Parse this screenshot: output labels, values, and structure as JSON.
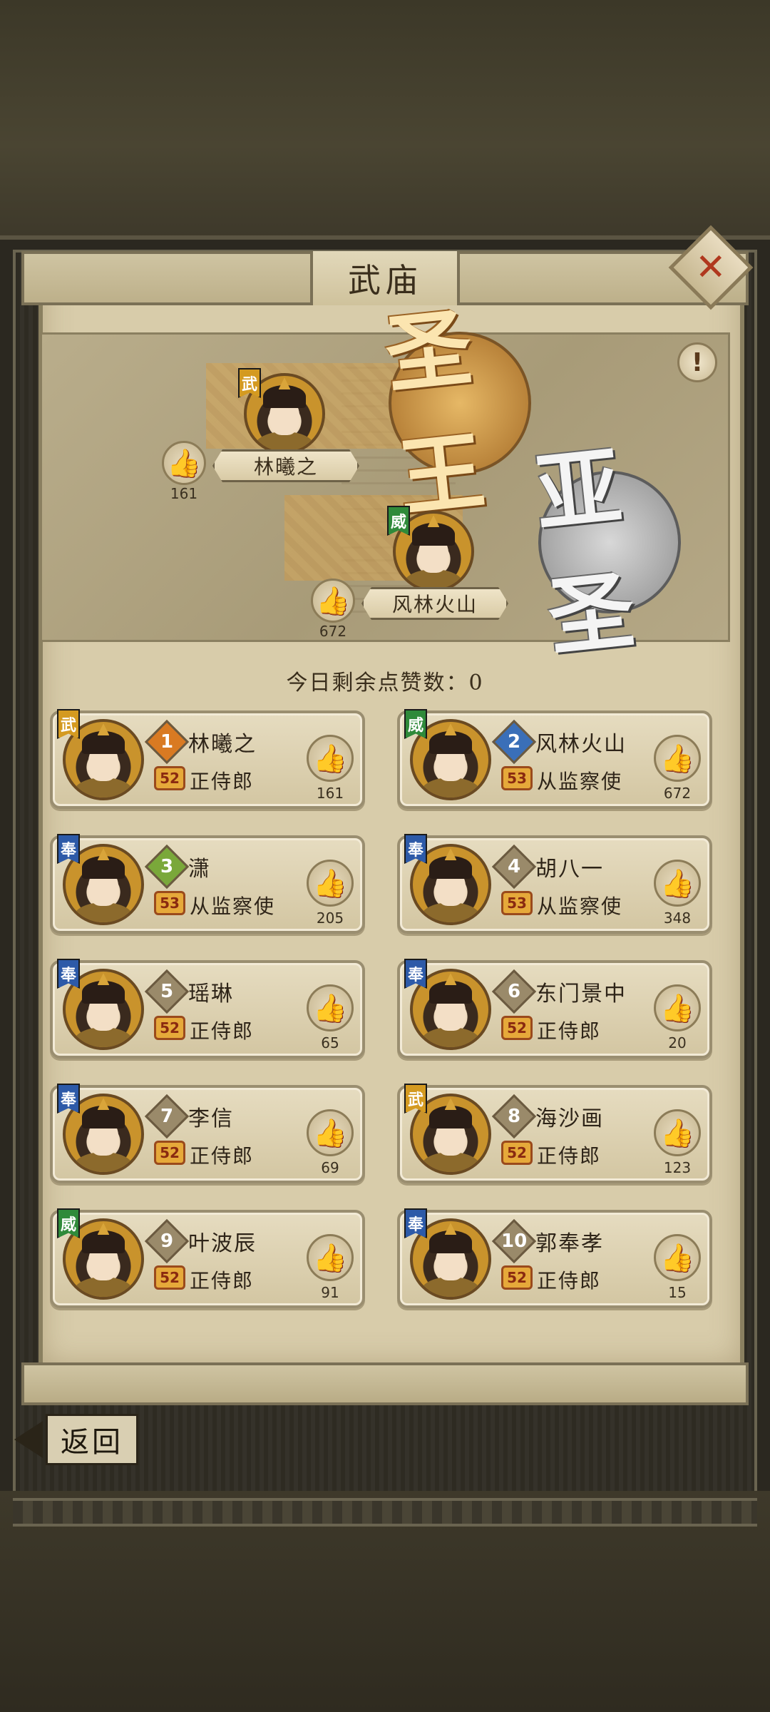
{
  "title": "武庙",
  "close_icon": "close-icon",
  "info_icon": "info-icon",
  "info_label": "!",
  "hall": {
    "sage_seal": "圣王",
    "second_sage_seal": "亚圣",
    "sage": {
      "name": "林曦之",
      "likes": "161",
      "faction": "武",
      "faction_color": "#d49a20"
    },
    "second_sage": {
      "name": "风林火山",
      "likes": "672",
      "faction": "威",
      "faction_color": "#2f8a3a"
    }
  },
  "remaining_likes": "今日剩余点赞数：0",
  "ranking": [
    {
      "rank": "1",
      "name": "林曦之",
      "level": "52",
      "title": "正侍郎",
      "likes": "161",
      "faction": "武",
      "faction_color": "#d49a20",
      "rank_color": "#d97a22"
    },
    {
      "rank": "2",
      "name": "风林火山",
      "level": "53",
      "title": "从监察使",
      "likes": "672",
      "faction": "威",
      "faction_color": "#2f8a3a",
      "rank_color": "#3a6fb8"
    },
    {
      "rank": "3",
      "name": "潇",
      "level": "53",
      "title": "从监察使",
      "likes": "205",
      "faction": "奉",
      "faction_color": "#2d5aa8",
      "rank_color": "#7aa83a"
    },
    {
      "rank": "4",
      "name": "胡八一",
      "level": "53",
      "title": "从监察使",
      "likes": "348",
      "faction": "奉",
      "faction_color": "#2d5aa8",
      "rank_color": "#9a8a6a"
    },
    {
      "rank": "5",
      "name": "瑶琳",
      "level": "52",
      "title": "正侍郎",
      "likes": "65",
      "faction": "奉",
      "faction_color": "#2d5aa8",
      "rank_color": "#9a8a6a"
    },
    {
      "rank": "6",
      "name": "东门景中",
      "level": "52",
      "title": "正侍郎",
      "likes": "20",
      "faction": "奉",
      "faction_color": "#2d5aa8",
      "rank_color": "#9a8a6a"
    },
    {
      "rank": "7",
      "name": "李信",
      "level": "52",
      "title": "正侍郎",
      "likes": "69",
      "faction": "奉",
      "faction_color": "#2d5aa8",
      "rank_color": "#9a8a6a"
    },
    {
      "rank": "8",
      "name": "海沙画",
      "level": "52",
      "title": "正侍郎",
      "likes": "123",
      "faction": "武",
      "faction_color": "#d49a20",
      "rank_color": "#9a8a6a"
    },
    {
      "rank": "9",
      "name": "叶波辰",
      "level": "52",
      "title": "正侍郎",
      "likes": "91",
      "faction": "威",
      "faction_color": "#2f8a3a",
      "rank_color": "#9a8a6a"
    },
    {
      "rank": "10",
      "name": "郭奉孝",
      "level": "52",
      "title": "正侍郎",
      "likes": "15",
      "faction": "奉",
      "faction_color": "#2d5aa8",
      "rank_color": "#9a8a6a"
    }
  ],
  "like_icon": "thumbs-up-icon",
  "like_glyph": "👍",
  "back_label": "返回",
  "back_icon": "back-arrow-icon"
}
